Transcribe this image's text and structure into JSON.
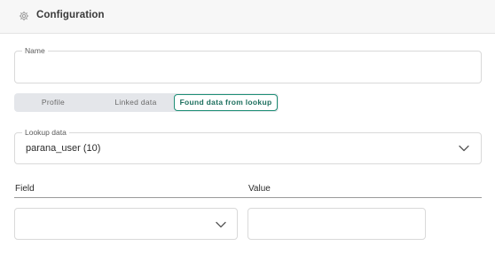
{
  "header": {
    "title": "Configuration",
    "icon": "gear-icon"
  },
  "name_field": {
    "label": "Name",
    "value": ""
  },
  "tabs": [
    {
      "label": "Profile",
      "active": false
    },
    {
      "label": "Linked data",
      "active": false
    },
    {
      "label": "Found data from lookup",
      "active": true
    }
  ],
  "lookup": {
    "label": "Lookup data",
    "value": "parana_user (10)"
  },
  "mapping": {
    "field_header": "Field",
    "value_header": "Value",
    "field_value": "",
    "value_value": ""
  },
  "colors": {
    "accent": "#1f8f76",
    "accent_text": "#1d6f5e",
    "segment_bg": "#e4e6ea",
    "border": "#d9d9d9"
  }
}
